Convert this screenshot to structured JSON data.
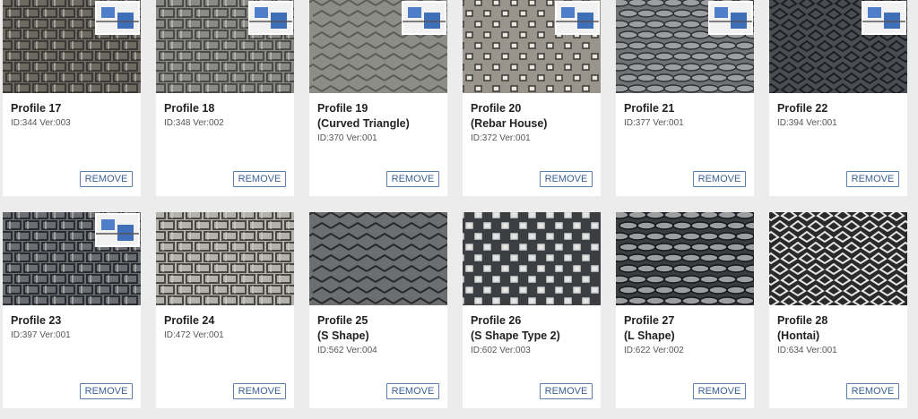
{
  "remove_label": "REMOVE",
  "profiles": [
    {
      "line1": "Profile 17",
      "line2": "",
      "meta": "ID:344 Ver:003",
      "icon": "profile-17-thumbnail",
      "tone": "#6d6a62",
      "accent": "#3c3a36",
      "inset": true
    },
    {
      "line1": "Profile 18",
      "line2": "",
      "meta": "ID:348 Ver:002",
      "icon": "profile-18-thumbnail",
      "tone": "#8a8a86",
      "accent": "#4a4a48",
      "inset": true
    },
    {
      "line1": "Profile 19",
      "line2": "(Curved Triangle)",
      "meta": "ID:370 Ver:001",
      "icon": "profile-19-thumbnail",
      "tone": "#8c8e86",
      "accent": "#5a5c56",
      "inset": true
    },
    {
      "line1": "Profile 20",
      "line2": "(Rebar House)",
      "meta": "ID:372 Ver:001",
      "icon": "profile-20-thumbnail",
      "tone": "#9a958c",
      "accent": "#3a3834",
      "inset": true
    },
    {
      "line1": "Profile 21",
      "line2": "",
      "meta": "ID:377 Ver:001",
      "icon": "profile-21-thumbnail",
      "tone": "#707276",
      "accent": "#2e3034",
      "inset": true
    },
    {
      "line1": "Profile 22",
      "line2": "",
      "meta": "ID:394 Ver:001",
      "icon": "profile-22-thumbnail",
      "tone": "#4a4d52",
      "accent": "#1c1e22",
      "inset": true
    },
    {
      "line1": "Profile 23",
      "line2": "",
      "meta": "ID:397 Ver:001",
      "icon": "profile-23-thumbnail",
      "tone": "#6a6d72",
      "accent": "#2a2c30",
      "inset": true
    },
    {
      "line1": "Profile 24",
      "line2": "",
      "meta": "ID:472 Ver:001",
      "icon": "profile-24-thumbnail",
      "tone": "#b4b2ac",
      "accent": "#4a4844",
      "inset": false
    },
    {
      "line1": "Profile 25",
      "line2": "(S Shape)",
      "meta": "ID:562 Ver:004",
      "icon": "profile-25-thumbnail",
      "tone": "#6c6e70",
      "accent": "#26282a",
      "inset": false
    },
    {
      "line1": "Profile 26",
      "line2": "(S Shape Type 2)",
      "meta": "ID:602 Ver:003",
      "icon": "profile-26-thumbnail",
      "tone": "#3c3e42",
      "accent": "#cfd2d6",
      "inset": false
    },
    {
      "line1": "Profile 27",
      "line2": "(L Shape)",
      "meta": "ID:622 Ver:002",
      "icon": "profile-27-thumbnail",
      "tone": "#3a3c40",
      "accent": "#15161a",
      "inset": false
    },
    {
      "line1": "Profile 28",
      "line2": "(Hontai)",
      "meta": "ID:634 Ver:001",
      "icon": "profile-28-thumbnail",
      "tone": "#2a2a2a",
      "accent": "#e6e6e6",
      "inset": false
    }
  ]
}
